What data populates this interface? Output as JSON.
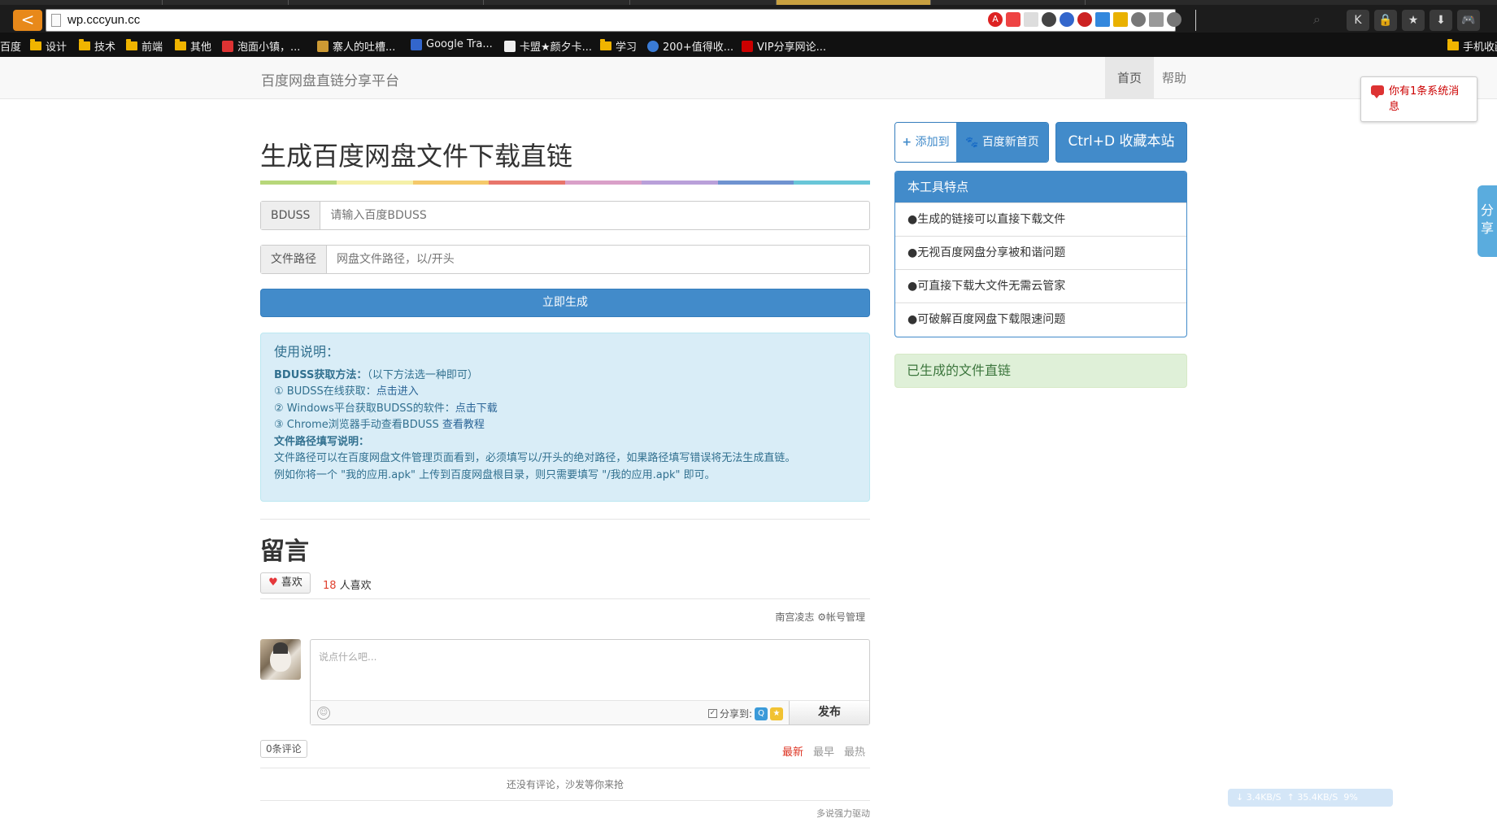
{
  "browser": {
    "url": "wp.cccyun.cc",
    "back_glyph": "<",
    "search_glyph": "⌕",
    "toolbar_icons": [
      "K",
      "🔒",
      "★",
      "⬇",
      "🎮"
    ]
  },
  "bookmarks": [
    {
      "label": "百度",
      "icon": "none"
    },
    {
      "label": "设计",
      "icon": "folder"
    },
    {
      "label": "技术",
      "icon": "folder"
    },
    {
      "label": "前端",
      "icon": "folder"
    },
    {
      "label": "其他",
      "icon": "folder"
    },
    {
      "label": "泡面小镇，...",
      "icon": "site"
    },
    {
      "label": "寨人的吐槽...",
      "icon": "site"
    },
    {
      "label": "Google Tra...",
      "icon": "site"
    },
    {
      "label": "卡盟★颜夕卡...",
      "icon": "site"
    },
    {
      "label": "学习",
      "icon": "folder"
    },
    {
      "label": "200+值得收...",
      "icon": "site"
    },
    {
      "label": "VIP分享网论...",
      "icon": "site"
    },
    {
      "label": "手机收藏",
      "icon": "folder"
    }
  ],
  "navbar": {
    "brand": "百度网盘直链分享平台",
    "items": [
      {
        "label": "首页",
        "active": true
      },
      {
        "label": "帮助",
        "active": false
      }
    ]
  },
  "notice": {
    "text": "你有1条系统消息"
  },
  "share_side": {
    "label": "分享"
  },
  "main": {
    "title": "生成百度网盘文件下载直链",
    "color_bar": [
      "#b7d77a",
      "#f5f0a8",
      "#f5c96a",
      "#e8756b",
      "#d9a0c8",
      "#b9a0d9",
      "#6f93d0",
      "#69c6d8"
    ],
    "bduss": {
      "label": "BDUSS",
      "placeholder": "请输入百度BDUSS"
    },
    "path": {
      "label": "文件路径",
      "placeholder": "网盘文件路径，以/开头"
    },
    "generate_label": "立即生成",
    "instructions": {
      "title": "使用说明：",
      "bduss_heading": "BDUSS获取方法：",
      "bduss_heading_note": "（以下方法选一种即可）",
      "line1_text": "① BUDSS在线获取：",
      "line1_link": "点击进入",
      "line2_text": "② Windows平台获取BUDSS的软件：",
      "line2_link": "点击下载",
      "line3_text": "③ Chrome浏览器手动查看BDUSS ",
      "line3_link": "查看教程",
      "path_heading": "文件路径填写说明：",
      "path_line1": "文件路径可以在百度网盘文件管理页面看到，必须填写以/开头的绝对路径，如果路径填写错误将无法生成直链。",
      "path_line2": "例如你将一个 \"我的应用.apk\" 上传到百度网盘根目录，则只需要填写 \"/我的应用.apk\" 即可。"
    }
  },
  "comments": {
    "title": "留言",
    "like_label": "喜欢",
    "like_count": "18",
    "like_suffix": " 人喜欢",
    "user_name": "南宫凌志",
    "account_manage": "帐号管理",
    "placeholder": "说点什么吧...",
    "share_to": "分享到:",
    "publish": "发布",
    "count_label": "0条评论",
    "sort": [
      "最新",
      "最早",
      "最热"
    ],
    "empty": "还没有评论，沙发等你来抢",
    "powered": "多说强力驱动"
  },
  "sidebar": {
    "add_to": "添加到",
    "baidu_home": "百度新首页",
    "bookmark_btn": "Ctrl+D 收藏本站",
    "features_title": "本工具特点",
    "features": [
      "●生成的链接可以直接下载文件",
      "●无视百度网盘分享被和谐问题",
      "●可直接下载大文件无需云管家",
      "●可破解百度网盘下载限速问题"
    ],
    "generated_links": "已生成的文件直链"
  },
  "speed": {
    "down": "3.4KB/S",
    "up": "35.4KB/S",
    "pct": "9%"
  }
}
